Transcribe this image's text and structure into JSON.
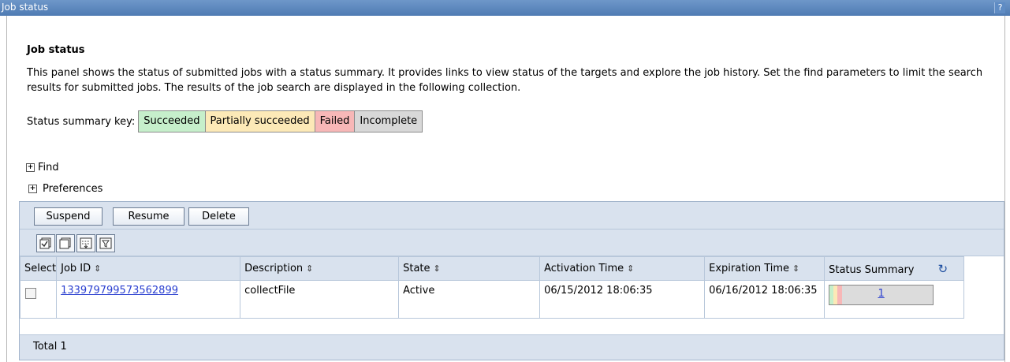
{
  "window": {
    "title": "Job status",
    "help_label": "?"
  },
  "page": {
    "heading": "Job status",
    "description": "This panel shows the status of submitted jobs with a status summary. It provides links to view status of the targets and explore the job history. Set the find parameters to limit the search results for submitted jobs. The results of the job search are displayed in the following collection."
  },
  "status_key": {
    "label": "Status summary key:",
    "items": [
      {
        "label": "Succeeded",
        "color": "#c6efcb"
      },
      {
        "label": "Partially succeeded",
        "color": "#fce9b7"
      },
      {
        "label": "Failed",
        "color": "#f7b7b7"
      },
      {
        "label": "Incomplete",
        "color": "#d8d8d8"
      }
    ]
  },
  "sections": {
    "find": "Find",
    "preferences": "Preferences"
  },
  "toolbar": {
    "suspend": "Suspend",
    "resume": "Resume",
    "delete": "Delete"
  },
  "icon_toolbar": [
    "select-all-icon",
    "deselect-all-icon",
    "show-filter-icon",
    "clear-filter-icon"
  ],
  "table": {
    "headers": [
      "Select",
      "Job ID",
      "Description",
      "State",
      "Activation Time",
      "Expiration Time",
      "Status Summary"
    ],
    "rows": [
      {
        "job_id": "133979799573562899",
        "description": "collectFile",
        "state": "Active",
        "activation_time": "06/15/2012 18:06:35",
        "expiration_time": "06/16/2012 18:06:35",
        "status_summary": "1"
      }
    ],
    "total": "Total 1"
  },
  "colors": {
    "title_bar": "#5a86bd",
    "link": "#2a3fd0",
    "panel_bg": "#d9e2ee"
  }
}
